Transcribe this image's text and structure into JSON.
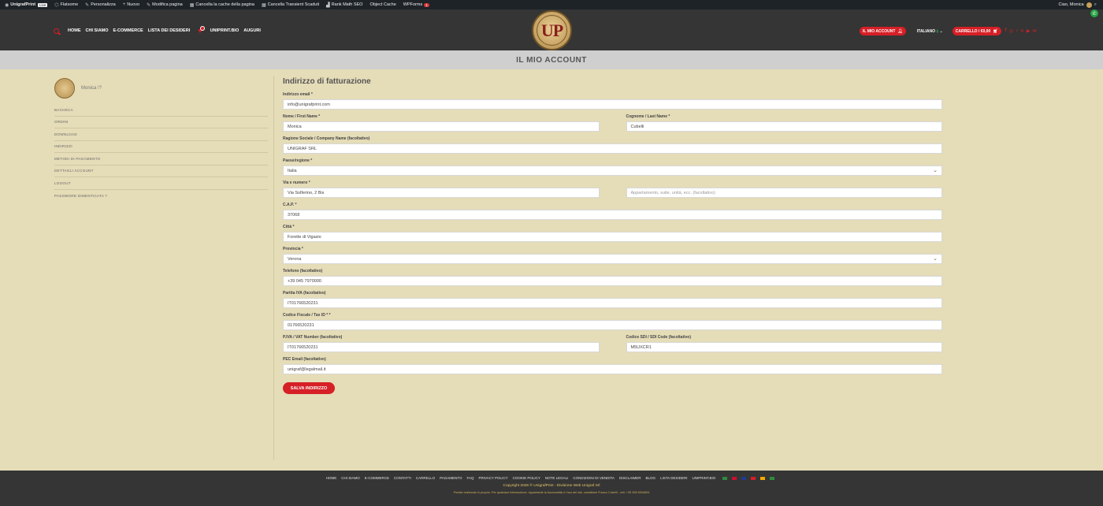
{
  "adminbar": {
    "site_name": "UnigrafPrint",
    "live_badge": "Live",
    "items": [
      "Flatsome",
      "Personalizza",
      "Nuovo",
      "Modifica pagina",
      "Cancella la cache della pagina",
      "Cancella Transient Scaduti",
      "Rank Math SEO",
      "Object Cache",
      "WPForms"
    ],
    "wpforms_count": "1",
    "greeting": "Ciao, Monica"
  },
  "header": {
    "nav": [
      "HOME",
      "CHI SIAMO",
      "E-COMMERCE",
      "LISTA DEI DESIDERI"
    ],
    "nav2": [
      "UNIPRINT.BIO",
      "AUGURI"
    ],
    "logo_text": "UP",
    "account_label": "IL MIO ACCOUNT",
    "language": "ITALIANO",
    "cart_label": "CARRELLO / €0,00",
    "social_icons": [
      "facebook-icon",
      "instagram-icon",
      "tiktok-icon",
      "x-icon",
      "youtube-icon",
      "email-icon"
    ]
  },
  "page_title": "IL MIO ACCOUNT",
  "sidebar": {
    "username": "Monica !?",
    "items": [
      "BACHECA",
      "ORDINI",
      "DOWNLOAD",
      "INDIRIZZI",
      "METODI DI PAGAMENTO",
      "DETTAGLI ACCOUNT",
      "LOGOUT",
      "PASSWORD DIMENTICATA ?"
    ]
  },
  "form": {
    "heading": "Indirizzo di fatturazione",
    "email": {
      "label": "Indirizzo email *",
      "value": "info@unigrafprint.com"
    },
    "first_name": {
      "label": "Nome / First Name *",
      "value": "Monica"
    },
    "last_name": {
      "label": "Cognome / Last Name *",
      "value": "Cubelli"
    },
    "company": {
      "label": "Ragione Sociale / Company Name (facoltativo)",
      "value": "UNIGRAF SRL"
    },
    "country": {
      "label": "Paese/regione *",
      "value": "Italia"
    },
    "address1": {
      "label": "Via e numero *",
      "value": "Via Solferino, 2 Bis"
    },
    "address2": {
      "placeholder": "Appartamento, suite, unità, ecc. (facoltativo)"
    },
    "cap": {
      "label": "C.A.P. *",
      "value": "37068"
    },
    "city": {
      "label": "Città *",
      "value": "Forette di Vigasio"
    },
    "province": {
      "label": "Provincia *",
      "value": "Verona"
    },
    "phone": {
      "label": "Telefono (facoltativo)",
      "value": "+39 045 7970000"
    },
    "vat": {
      "label": "Partita IVA (facoltativo)",
      "value": "IT01766520231"
    },
    "tax_code": {
      "label": "Codice Fiscale / Tax ID * *",
      "value": "01766520231"
    },
    "piva": {
      "label": "P.IVA / VAT Number (facoltativo)",
      "value": "IT01766520231"
    },
    "sdi": {
      "label": "Codice SDI / SDI Code (facoltativo)",
      "value": "M5UXCR1"
    },
    "pec": {
      "label": "PEC Email (facoltativo)",
      "value": "unigraf@legalmail.it"
    },
    "save_label": "SALVA INDIRIZZO"
  },
  "footer": {
    "links": [
      "HOME",
      "CHI SIAMO",
      "E-COMMERCE",
      "CONTATTI",
      "CARRELLO",
      "PAGAMENTO",
      "FAQ",
      "PRIVACY POLICY",
      "COOKIE POLICY",
      "NOTE LEGALI",
      "CONDIZIONI DI VENDITA",
      "DISCLAIMER",
      "BLOG",
      "LISTA DESIDERI",
      "UNIPRINT.BIO"
    ],
    "copyright": "Copyright 2026 © UnigrafPrint - Divisione Web Unigraf Srl",
    "credits": "Portale realizzato in proprio. Per qualsiasi informazione, riguardante la funzionalità e l'uso del sito, contattare Franco Cubelli - cell. +39 335 6034604",
    "flag_colors": [
      "#2e8b3e",
      "#c8102e",
      "#1f3b8f",
      "#d61f26",
      "#f2a900",
      "#2e8b3e"
    ]
  }
}
